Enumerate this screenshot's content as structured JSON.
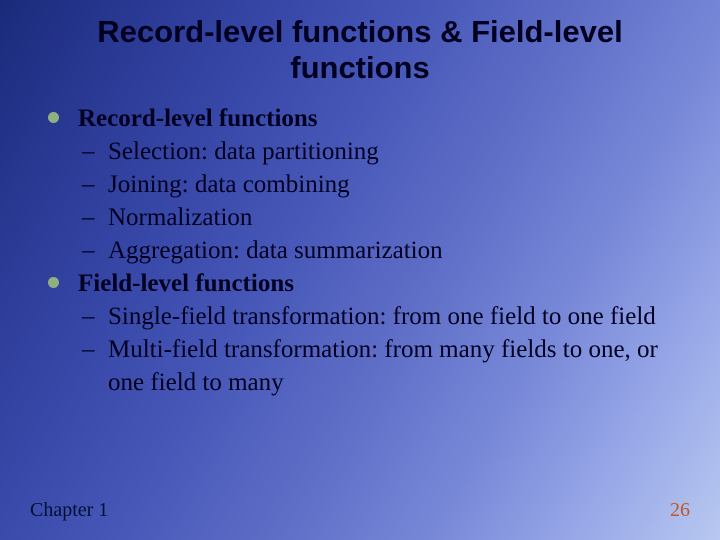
{
  "title": "Record-level functions & Field-level functions",
  "bullets": [
    {
      "label": "Record-level functions",
      "subs": [
        "Selection: data partitioning",
        "Joining: data combining",
        "Normalization",
        "Aggregation: data summarization"
      ]
    },
    {
      "label": "Field-level functions",
      "subs": [
        "Single-field transformation: from one field to one field",
        "Multi-field transformation: from many fields to one, or one field to many"
      ]
    }
  ],
  "footer": {
    "left": "Chapter 1",
    "right": "26"
  }
}
